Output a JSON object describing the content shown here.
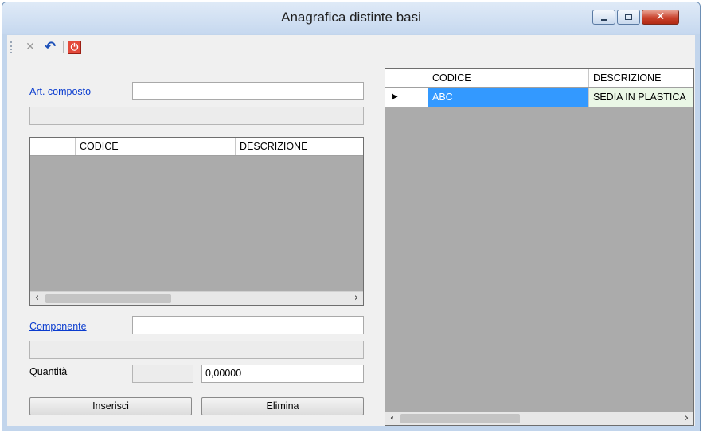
{
  "window": {
    "title": "Anagrafica distinte basi",
    "minimize_glyph": "",
    "maximize_glyph": "",
    "close_glyph": "✕"
  },
  "toolbar": {
    "cancel_glyph": "✕",
    "undo_glyph": "↶",
    "power_glyph": "⏻"
  },
  "left": {
    "art_composto_label": "Art. composto",
    "art_composto_value": "",
    "grid": {
      "headers": [
        "",
        "CODICE",
        "DESCRIZIONE"
      ],
      "scroll_left": "‹",
      "scroll_right": "›"
    },
    "componente_label": "Componente",
    "componente_value": "",
    "quantita_label": "Quantità",
    "quantita_value": "0,00000",
    "inserisci_label": "Inserisci",
    "elimina_label": "Elimina"
  },
  "right_grid": {
    "headers": [
      "",
      "CODICE",
      "DESCRIZIONE"
    ],
    "rows": [
      {
        "indicator": "▶",
        "codice": "ABC",
        "descrizione": "SEDIA IN PLASTICA"
      }
    ],
    "scroll_left": "‹",
    "scroll_right": "›"
  },
  "colors": {
    "selection": "#3399ff",
    "selected_row_bg": "#eaf7e6",
    "link": "#0a3ccf",
    "grid_bg": "#ababab"
  }
}
